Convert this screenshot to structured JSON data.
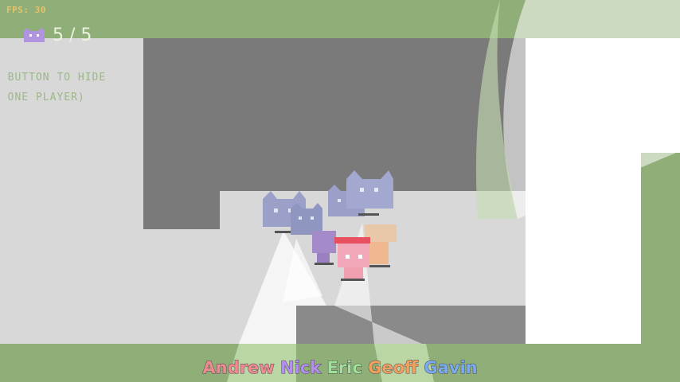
{
  "hud": {
    "fps": "FPS: 30",
    "cat_counter": "5 / 5"
  },
  "hints": {
    "line1": "K BUTTON TO HIDE",
    "line2": "Y ONE PLAYER)"
  },
  "players": [
    {
      "name": "Andrew",
      "color": "#f08a92"
    },
    {
      "name": "Nick",
      "color": "#b48ef0"
    },
    {
      "name": "Eric",
      "color": "#9fe09a"
    },
    {
      "name": "Geoff",
      "color": "#f2a060"
    },
    {
      "name": "Gavin",
      "color": "#7aaaf0"
    }
  ],
  "colors": {
    "grass": "#8fae78",
    "floor": "#d8d8d8",
    "wall": "#7a7a7a",
    "light": "#ffffff",
    "cat": "#9aa0c8"
  }
}
